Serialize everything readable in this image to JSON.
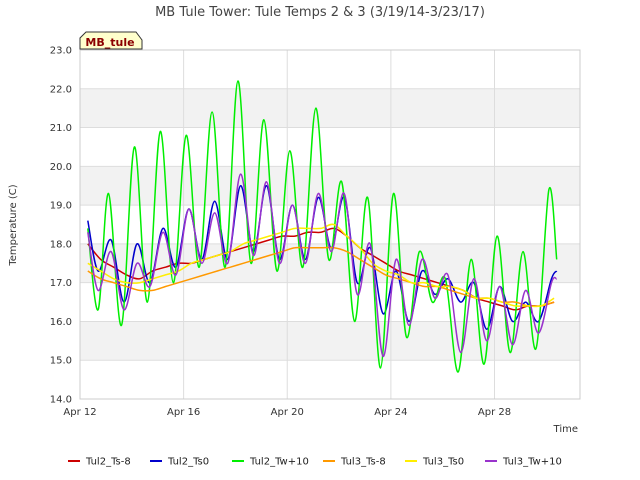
{
  "chart_data": {
    "type": "line",
    "title": "MB Tule Tower: Tule Temps 2 & 3 (3/19/14-3/23/17)",
    "xlabel": "Time",
    "ylabel": "Temperature (C)",
    "badge": "MB_tule",
    "xlim": [
      0,
      19.3
    ],
    "ylim": [
      14.0,
      23.0
    ],
    "x_ticks": [
      {
        "x": 0,
        "label": "Apr 12"
      },
      {
        "x": 4,
        "label": "Apr 16"
      },
      {
        "x": 8,
        "label": "Apr 20"
      },
      {
        "x": 12,
        "label": "Apr 24"
      },
      {
        "x": 16,
        "label": "Apr 28"
      }
    ],
    "y_ticks": [
      14.0,
      15.0,
      16.0,
      17.0,
      18.0,
      19.0,
      20.0,
      21.0,
      22.0,
      23.0
    ],
    "grid": true,
    "legend_position": "bottom",
    "series": [
      {
        "name": "Tul2_Ts-8",
        "color": "#cc0000",
        "x": [
          0.3,
          0.8,
          1.3,
          1.8,
          2.3,
          2.8,
          3.3,
          3.8,
          4.3,
          4.8,
          5.3,
          5.8,
          6.3,
          6.8,
          7.3,
          7.8,
          8.3,
          8.8,
          9.3,
          9.8,
          10.3,
          10.8,
          11.3,
          11.8,
          12.3,
          12.8,
          13.3,
          13.8,
          14.3,
          14.8,
          15.3,
          15.8,
          16.3,
          16.8,
          17.3,
          17.8,
          18.3
        ],
        "y": [
          18.0,
          17.6,
          17.4,
          17.2,
          17.1,
          17.3,
          17.4,
          17.5,
          17.5,
          17.6,
          17.7,
          17.8,
          17.9,
          18.0,
          18.1,
          18.2,
          18.2,
          18.3,
          18.3,
          18.4,
          18.2,
          17.9,
          17.7,
          17.5,
          17.3,
          17.2,
          17.1,
          17.0,
          16.9,
          16.8,
          16.6,
          16.5,
          16.4,
          16.3,
          16.4,
          16.4,
          16.5
        ]
      },
      {
        "name": "Tul2_Ts0",
        "color": "#0000cc",
        "x": [
          0.3,
          0.7,
          1.2,
          1.7,
          2.2,
          2.7,
          3.2,
          3.7,
          4.2,
          4.7,
          5.2,
          5.7,
          6.2,
          6.7,
          7.2,
          7.7,
          8.2,
          8.7,
          9.2,
          9.7,
          10.2,
          10.7,
          11.2,
          11.7,
          12.2,
          12.7,
          13.2,
          13.7,
          14.2,
          14.7,
          15.2,
          15.7,
          16.2,
          16.7,
          17.2,
          17.7,
          18.2,
          18.4
        ],
        "y": [
          18.6,
          17.3,
          18.1,
          16.5,
          18.0,
          17.0,
          18.4,
          17.4,
          18.9,
          17.6,
          19.1,
          17.6,
          19.5,
          17.8,
          19.5,
          17.6,
          19.0,
          17.6,
          19.2,
          17.9,
          19.2,
          17.0,
          17.9,
          16.2,
          17.3,
          16.0,
          17.3,
          16.7,
          17.1,
          16.5,
          17.0,
          15.8,
          16.9,
          16.0,
          16.5,
          16.0,
          17.1,
          17.3
        ]
      },
      {
        "name": "Tul2_Tw+10",
        "color": "#00ee00",
        "x": [
          0.3,
          0.7,
          1.1,
          1.6,
          2.1,
          2.6,
          3.1,
          3.6,
          4.1,
          4.6,
          5.1,
          5.6,
          6.1,
          6.6,
          7.1,
          7.6,
          8.1,
          8.6,
          9.1,
          9.6,
          10.1,
          10.6,
          11.1,
          11.6,
          12.1,
          12.6,
          13.1,
          13.6,
          14.1,
          14.6,
          15.1,
          15.6,
          16.1,
          16.6,
          17.1,
          17.6,
          18.1,
          18.4
        ],
        "y": [
          18.4,
          16.3,
          19.3,
          15.9,
          20.5,
          16.5,
          20.9,
          17.0,
          20.8,
          17.4,
          21.4,
          17.4,
          22.2,
          17.5,
          21.2,
          17.3,
          20.4,
          17.4,
          21.5,
          17.6,
          19.6,
          16.0,
          19.2,
          14.8,
          19.3,
          15.6,
          17.8,
          16.5,
          17.1,
          14.7,
          17.6,
          14.9,
          18.2,
          15.2,
          17.8,
          15.3,
          19.4,
          17.6
        ]
      },
      {
        "name": "Tul3_Ts-8",
        "color": "#ff9900",
        "x": [
          0.3,
          0.8,
          1.3,
          1.8,
          2.3,
          2.8,
          3.3,
          3.8,
          4.3,
          4.8,
          5.3,
          5.8,
          6.3,
          6.8,
          7.3,
          7.8,
          8.3,
          8.8,
          9.3,
          9.8,
          10.3,
          10.8,
          11.3,
          11.8,
          12.3,
          12.8,
          13.3,
          13.8,
          14.3,
          14.8,
          15.3,
          15.8,
          16.3,
          16.8,
          17.3,
          17.8,
          18.3
        ],
        "y": [
          17.3,
          17.1,
          17.0,
          16.9,
          16.8,
          16.8,
          16.9,
          17.0,
          17.1,
          17.2,
          17.3,
          17.4,
          17.5,
          17.6,
          17.7,
          17.8,
          17.9,
          17.9,
          17.9,
          17.9,
          17.8,
          17.6,
          17.4,
          17.2,
          17.1,
          17.0,
          16.9,
          16.9,
          16.8,
          16.7,
          16.6,
          16.6,
          16.5,
          16.5,
          16.4,
          16.4,
          16.5
        ]
      },
      {
        "name": "Tul3_Ts0",
        "color": "#ffee00",
        "x": [
          0.3,
          0.8,
          1.3,
          1.8,
          2.3,
          2.8,
          3.3,
          3.8,
          4.3,
          4.8,
          5.3,
          5.8,
          6.3,
          6.8,
          7.3,
          7.8,
          8.3,
          8.8,
          9.3,
          9.8,
          10.3,
          10.8,
          11.3,
          11.8,
          12.3,
          12.8,
          13.3,
          13.8,
          14.3,
          14.8,
          15.3,
          15.8,
          16.3,
          16.8,
          17.3,
          17.8,
          18.3
        ],
        "y": [
          17.5,
          17.3,
          17.1,
          17.0,
          17.0,
          17.1,
          17.2,
          17.3,
          17.5,
          17.6,
          17.7,
          17.8,
          18.0,
          18.1,
          18.2,
          18.3,
          18.4,
          18.4,
          18.4,
          18.5,
          18.2,
          17.9,
          17.5,
          17.3,
          17.2,
          17.0,
          17.0,
          16.9,
          16.9,
          16.8,
          16.6,
          16.6,
          16.5,
          16.4,
          16.4,
          16.4,
          16.6
        ]
      },
      {
        "name": "Tul3_Tw+10",
        "color": "#9933cc",
        "x": [
          0.3,
          0.7,
          1.2,
          1.7,
          2.2,
          2.7,
          3.2,
          3.7,
          4.2,
          4.7,
          5.2,
          5.7,
          6.2,
          6.7,
          7.2,
          7.7,
          8.2,
          8.7,
          9.2,
          9.7,
          10.2,
          10.7,
          11.2,
          11.7,
          12.2,
          12.7,
          13.2,
          13.7,
          14.2,
          14.7,
          15.2,
          15.7,
          16.2,
          16.7,
          17.2,
          17.7,
          18.2,
          18.4
        ],
        "y": [
          18.3,
          16.8,
          17.8,
          16.3,
          17.5,
          16.9,
          18.3,
          17.2,
          18.9,
          17.5,
          18.8,
          17.5,
          19.8,
          17.7,
          19.6,
          17.5,
          19.0,
          17.5,
          19.3,
          17.8,
          19.3,
          16.7,
          18.0,
          15.1,
          17.6,
          15.9,
          17.6,
          16.6,
          17.2,
          15.2,
          17.1,
          15.5,
          16.9,
          15.4,
          16.8,
          15.7,
          17.0,
          17.1
        ]
      }
    ]
  }
}
